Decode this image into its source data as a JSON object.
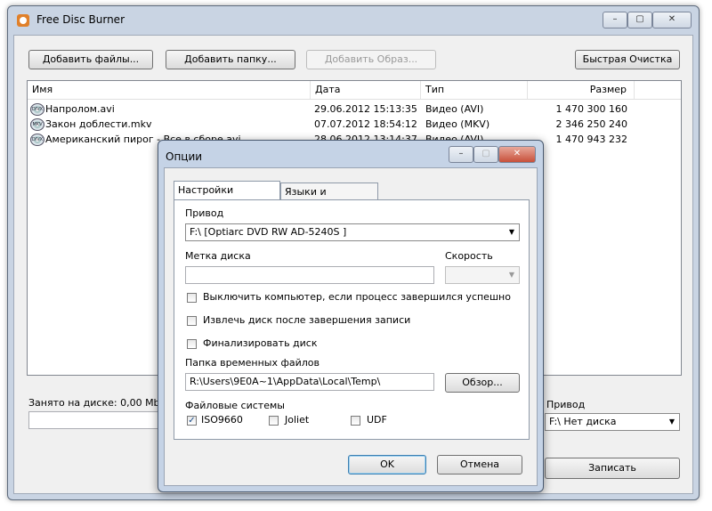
{
  "window": {
    "title": "Free Disc Burner"
  },
  "toolbar": {
    "add_files": "Добавить файлы...",
    "add_folder": "Добавить папку...",
    "add_image": "Добавить Образ...",
    "quick_clean": "Быстрая Очистка"
  },
  "list": {
    "columns": [
      "Имя",
      "Дата",
      "Тип",
      "Размер"
    ],
    "rows": [
      {
        "icon": "divx-file-icon",
        "badge": "DIVX",
        "name": "Напролом.avi",
        "date": "29.06.2012 15:13:35",
        "type": "Видео (AVI)",
        "size": "1 470 300 160"
      },
      {
        "icon": "mkv-file-icon",
        "badge": "MKV",
        "name": "Закон доблести.mkv",
        "date": "07.07.2012 18:54:12",
        "type": "Видео (MKV)",
        "size": "2 346 250 240"
      },
      {
        "icon": "divx-file-icon",
        "badge": "DIVX",
        "name": "Американский пирог - Все в сборе.avi",
        "date": "28.06.2012 13:14:37",
        "type": "Видео (AVI)",
        "size": "1 470 943 232"
      }
    ]
  },
  "bottom": {
    "disk_usage": "Занято на диске: 0,00 Mb",
    "drive_label": "Привод",
    "drive_value": "F:\\ Нет диска",
    "burn_button": "Записать"
  },
  "dialog": {
    "title": "Опции",
    "tabs": [
      "Настройки программы",
      "Языки и Обновления"
    ],
    "drive_label": "Привод",
    "drive_value": "F:\\ [Optiarc DVD RW AD-5240S ]",
    "disc_label": "Метка диска",
    "disc_value": "",
    "speed_label": "Скорость",
    "speed_value": "",
    "opt_shutdown": {
      "label": "Выключить компьютер, если процесс завершился успешно",
      "checked": false
    },
    "opt_eject": {
      "label": "Извлечь диск после завершения записи",
      "checked": false
    },
    "opt_finalize": {
      "label": "Финализировать диск",
      "checked": false
    },
    "temp_label": "Папка временных файлов",
    "temp_value": "R:\\Users\\9E0A~1\\AppData\\Local\\Temp\\",
    "browse": "Обзор...",
    "fs_label": "Файловые системы",
    "fs": [
      {
        "label": "ISO9660",
        "checked": true
      },
      {
        "label": "Joliet",
        "checked": false
      },
      {
        "label": "UDF",
        "checked": false
      }
    ],
    "ok": "OK",
    "cancel": "Отмена"
  }
}
